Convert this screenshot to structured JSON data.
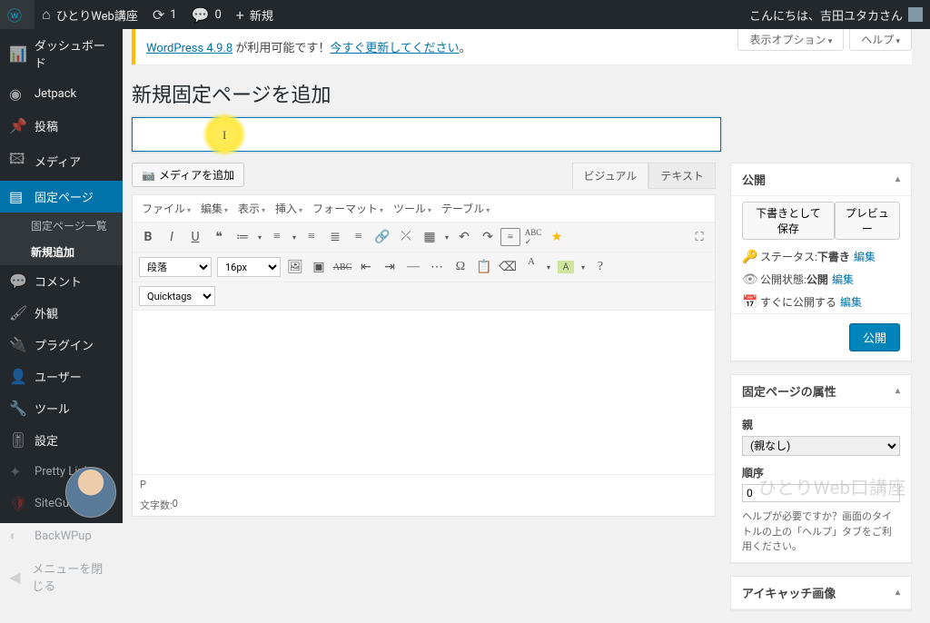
{
  "adminbar": {
    "site_name": "ひとりWeb講座",
    "updates": "1",
    "comments": "0",
    "new": "新規",
    "howdy_prefix": "こんにちは、",
    "user": "吉田ユタカ",
    "howdy_suffix": " さん"
  },
  "menu": {
    "dashboard": "ダッシュボード",
    "jetpack": "Jetpack",
    "posts": "投稿",
    "media": "メディア",
    "pages": "固定ページ",
    "pages_sub_all": "固定ページ一覧",
    "pages_sub_new": "新規追加",
    "comments": "コメント",
    "appearance": "外観",
    "plugins": "プラグイン",
    "users": "ユーザー",
    "tools": "ツール",
    "settings": "設定",
    "prettylinks": "Pretty Links",
    "siteguard": "SiteGuard",
    "backwpup": "BackWPup",
    "collapse": "メニューを閉じる"
  },
  "screen_meta": {
    "options": "表示オプション",
    "help": "ヘルプ"
  },
  "notice": {
    "link1": "WordPress 4.9.8",
    "mid": " が利用可能です！",
    "link2": "今すぐ更新してください",
    "end": "。"
  },
  "page_title": "新規固定ページを追加",
  "title_input": {
    "value": "",
    "placeholder": ""
  },
  "media_button": "メディアを追加",
  "tabs": {
    "visual": "ビジュアル",
    "text": "テキスト"
  },
  "menubar": {
    "file": "ファイル",
    "edit": "編集",
    "view": "表示",
    "insert": "挿入",
    "format": "フォーマット",
    "tools": "ツール",
    "table": "テーブル"
  },
  "toolbar": {
    "paragraph": "段落",
    "fontsize": "16px",
    "quicktags": "Quicktags"
  },
  "status": {
    "path": "P",
    "wordcount_label": "文字数: ",
    "wordcount": "0"
  },
  "publish": {
    "box_title": "公開",
    "save_draft": "下書きとして保存",
    "preview": "プレビュー",
    "status_label": "ステータス: ",
    "status_value": "下書き",
    "edit": "編集",
    "visibility_label": "公開状態: ",
    "visibility_value": "公開",
    "schedule_label": "すぐに公開する ",
    "publish_btn": "公開"
  },
  "attributes": {
    "box_title": "固定ページの属性",
    "parent_label": "親",
    "parent_value": "(親なし)",
    "order_label": "順序",
    "order_value": "0",
    "help": "ヘルプが必要ですか？画面のタイトルの上の「ヘルプ」タブをご利用ください。"
  },
  "featured": {
    "box_title": "アイキャッチ画像"
  },
  "watermark": "ひとりWeb口講座"
}
